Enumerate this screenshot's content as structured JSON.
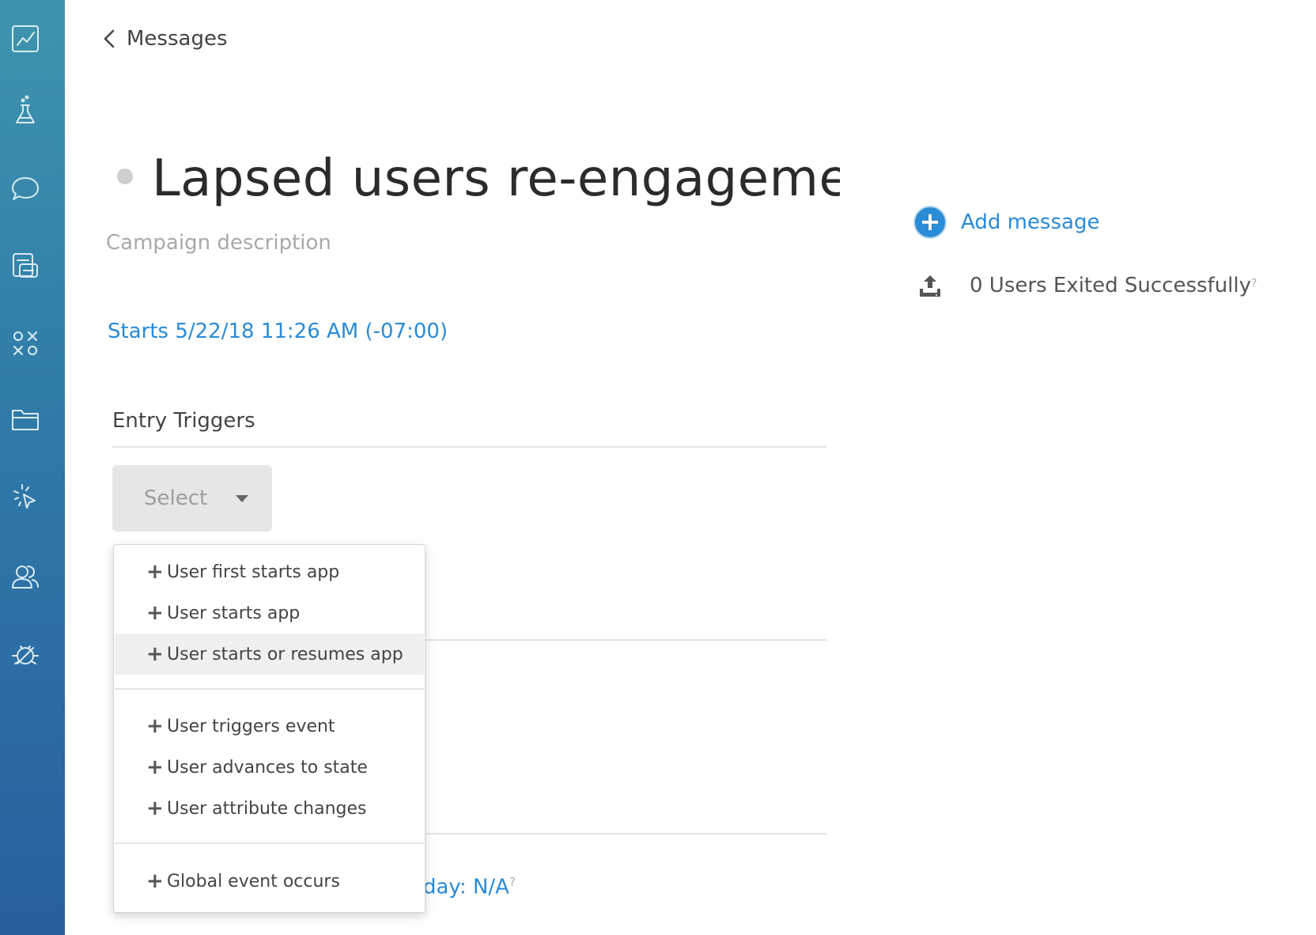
{
  "sidebar": {
    "icons": [
      "analytics-icon",
      "flask-icon",
      "chat-bubble-icon",
      "layers-icon",
      "variables-icon",
      "folder-icon",
      "click-pointer-icon",
      "users-icon",
      "bug-icon"
    ]
  },
  "header": {
    "back_label": "Messages"
  },
  "campaign": {
    "title": "Lapsed users re-engagement",
    "description_placeholder": "Campaign description",
    "start_text": "Starts 5/22/18 11:26 AM (-07:00)"
  },
  "entry_triggers": {
    "label": "Entry Triggers",
    "select_label": "Select"
  },
  "dropdown": {
    "group1": [
      "User first starts app",
      "User starts app",
      "User starts or resumes app"
    ],
    "group2": [
      "User triggers event",
      "User advances to state",
      "User attribute changes"
    ],
    "group3": [
      "Global event occurs"
    ],
    "highlighted": "User starts or resumes app"
  },
  "behind_text": "day: N/A",
  "help_mark": "?",
  "right_panel": {
    "add_message_label": "Add message",
    "exited_label": "0 Users Exited Successfully"
  },
  "colors": {
    "accent": "#2a8bd6",
    "sidebar_top": "#3f94ad",
    "sidebar_bottom": "#2a5f9f"
  }
}
